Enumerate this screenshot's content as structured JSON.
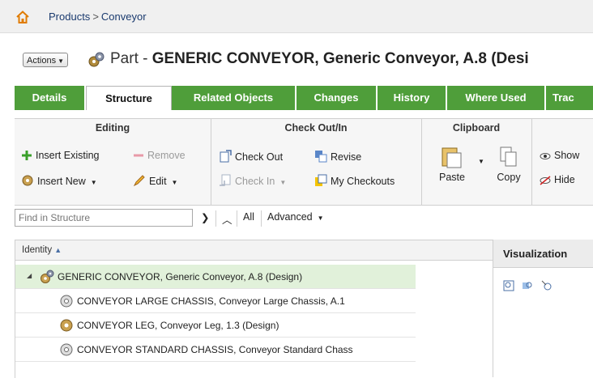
{
  "breadcrumb": {
    "products": "Products",
    "separator": ">",
    "current": "Conveyor"
  },
  "header": {
    "actions_label": "Actions",
    "title_prefix": "Part - ",
    "title_main": "GENERIC CONVEYOR, Generic Conveyor, A.8 (Desi"
  },
  "tabs": [
    {
      "label": "Details",
      "active": false
    },
    {
      "label": "Structure",
      "active": true
    },
    {
      "label": "Related Objects",
      "active": false
    },
    {
      "label": "Changes",
      "active": false
    },
    {
      "label": "History",
      "active": false
    },
    {
      "label": "Where Used",
      "active": false
    },
    {
      "label": "Trac",
      "active": false
    }
  ],
  "toolbar": {
    "editing": {
      "title": "Editing",
      "insert_existing": "Insert Existing",
      "remove": "Remove",
      "insert_new": "Insert New",
      "edit": "Edit"
    },
    "checkout": {
      "title": "Check Out/In",
      "check_out": "Check Out",
      "revise": "Revise",
      "check_in": "Check In",
      "my_checkouts": "My Checkouts"
    },
    "clipboard": {
      "title": "Clipboard",
      "paste": "Paste",
      "copy": "Copy"
    },
    "view": {
      "show": "Show",
      "hide": "Hide"
    }
  },
  "search": {
    "placeholder": "Find in Structure",
    "all": "All",
    "advanced": "Advanced"
  },
  "tree": {
    "column": "Identity",
    "rows": [
      {
        "label": "GENERIC CONVEYOR, Generic Conveyor, A.8 (Design)"
      },
      {
        "label": "CONVEYOR LARGE CHASSIS, Conveyor Large Chassis, A.1"
      },
      {
        "label": "CONVEYOR LEG, Conveyor Leg, 1.3 (Design)"
      },
      {
        "label": "CONVEYOR STANDARD CHASSIS, Conveyor Standard Chass"
      }
    ]
  },
  "visualization": {
    "title": "Visualization"
  },
  "colors": {
    "tab_green": "#4f9e3a",
    "selected_row": "#e1f1da",
    "link_blue": "#1a3a6e"
  }
}
